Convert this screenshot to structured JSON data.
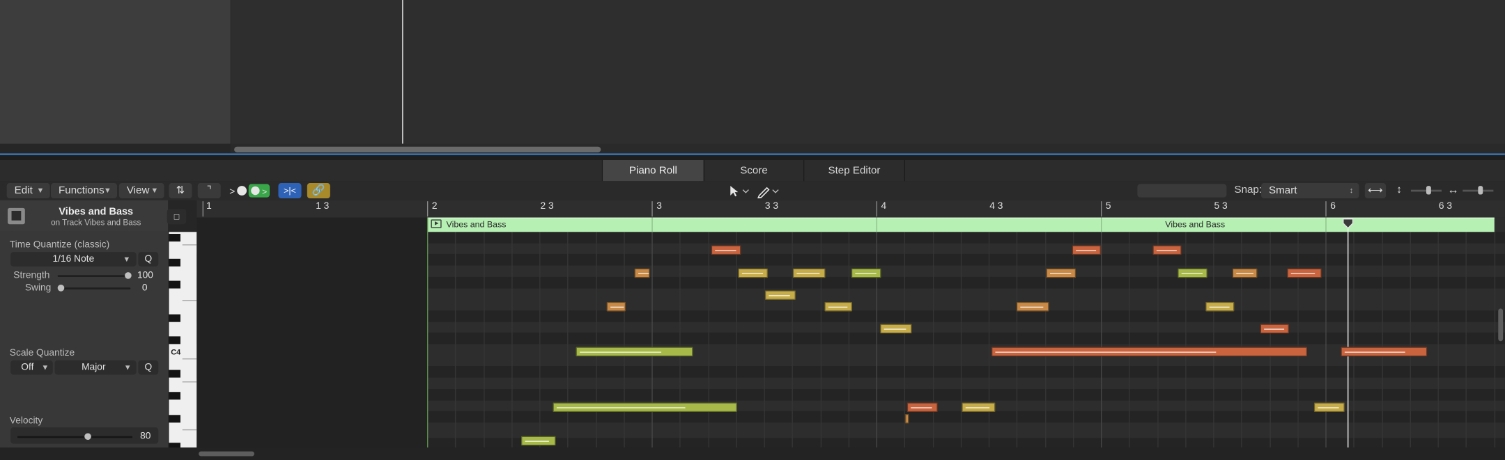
{
  "tabs": [
    "Piano Roll",
    "Score",
    "Step Editor"
  ],
  "toolbar": {
    "edit": "Edit",
    "functions": "Functions",
    "view": "View",
    "snap_label": "Snap:",
    "snap_value": "Smart"
  },
  "inspector": {
    "region_name": "Vibes and Bass",
    "track_line": "on Track Vibes and Bass",
    "time_quantize_title": "Time Quantize (classic)",
    "time_quantize_value": "1/16 Note",
    "q_label": "Q",
    "strength_label": "Strength",
    "strength_value": "100",
    "swing_label": "Swing",
    "swing_value": "0",
    "scale_quantize_title": "Scale Quantize",
    "scale_off": "Off",
    "scale_major": "Major",
    "velocity_title": "Velocity",
    "velocity_value": "80"
  },
  "keyboard": {
    "c4_label": "C4"
  },
  "ruler": {
    "bars": [
      "1",
      "1 3",
      "2",
      "2 3",
      "3",
      "3 3",
      "4",
      "4 3",
      "5",
      "5 3",
      "6",
      "6 3"
    ]
  },
  "region": {
    "name": "Vibes and Bass",
    "name_repeat": "Vibes and Bass"
  },
  "colors": {
    "note_green": "#a7b948",
    "note_yellow": "#c6ad4a",
    "note_orange": "#c88a46",
    "note_red": "#c9643f",
    "region_header": "#b6f0b3",
    "selection_blue": "#3a6ea8"
  }
}
